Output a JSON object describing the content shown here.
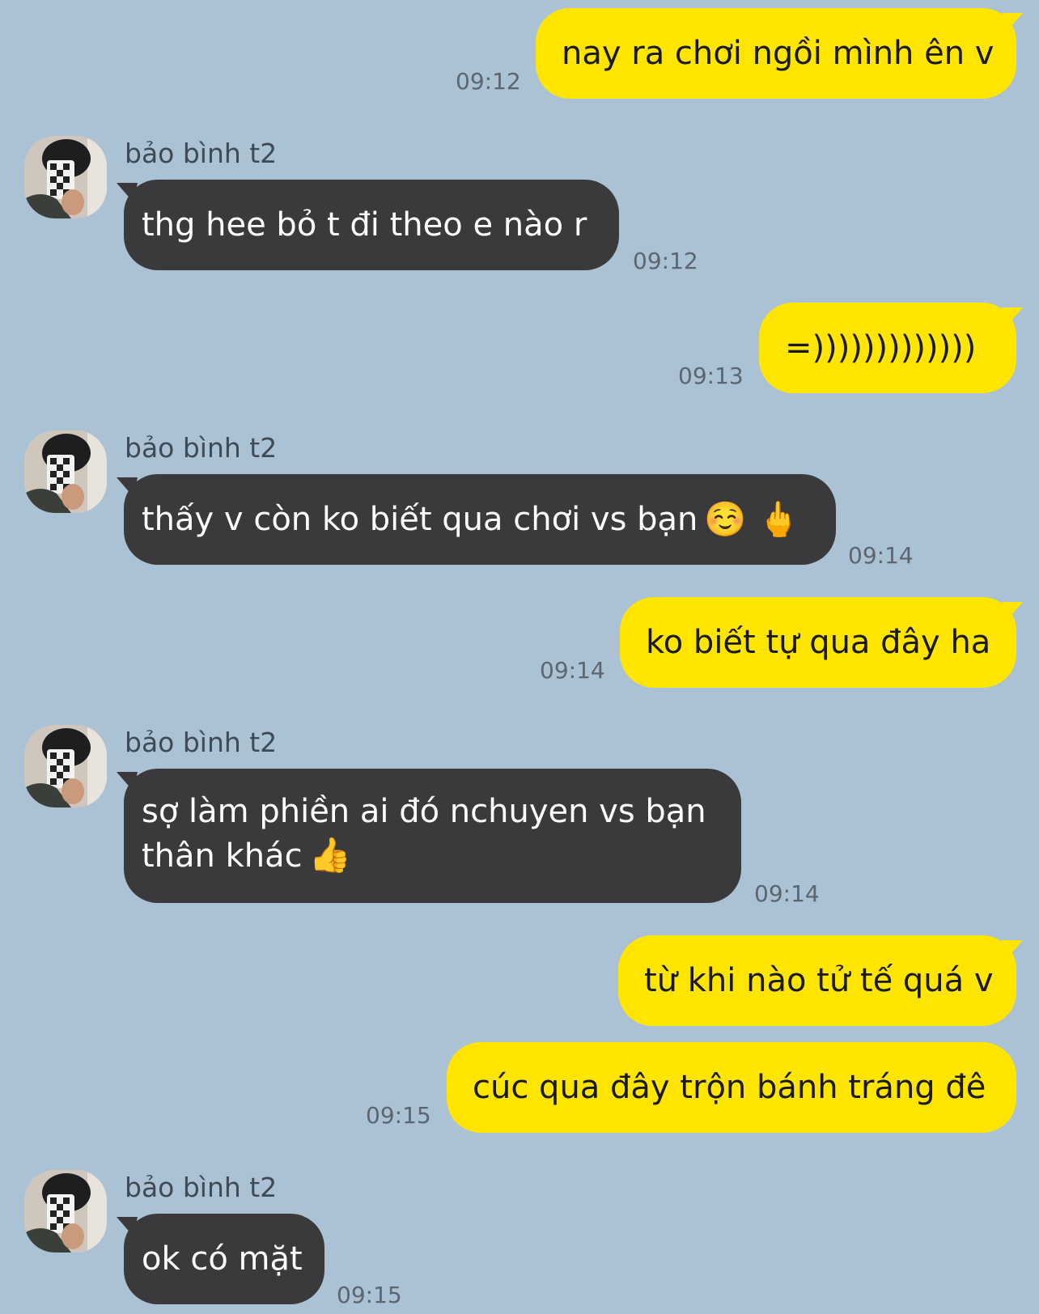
{
  "contact": {
    "name": "bảo bình t2"
  },
  "messages": [
    {
      "from": "me",
      "text": "nay ra chơi ngồi mình ên v",
      "time": "09:12"
    },
    {
      "from": "contact",
      "text": "thg hee bỏ t đi theo e nào r",
      "time": "09:12"
    },
    {
      "from": "me",
      "text": "=)))))))))))))",
      "time": "09:13"
    },
    {
      "from": "contact",
      "text": "thấy v còn ko biết qua chơi vs bạn",
      "emoji": "☺️ 🖕",
      "time": "09:14"
    },
    {
      "from": "me",
      "text": "ko biết tự qua đây ha",
      "time": "09:14"
    },
    {
      "from": "contact",
      "text": "sợ làm phiền ai đó nchuyen vs bạn thân khác",
      "emoji": "👍",
      "time": "09:14"
    },
    {
      "from": "me",
      "text": "từ khi nào tử tế quá v",
      "time": ""
    },
    {
      "from": "me",
      "text": "cúc qua đây trộn bánh tráng đê",
      "time": "09:15"
    },
    {
      "from": "contact",
      "text": "ok có mặt",
      "time": "09:15"
    }
  ],
  "colors": {
    "background": "#abc1d4",
    "outgoing_bubble": "#ffe500",
    "incoming_bubble": "#3a3a3c"
  }
}
